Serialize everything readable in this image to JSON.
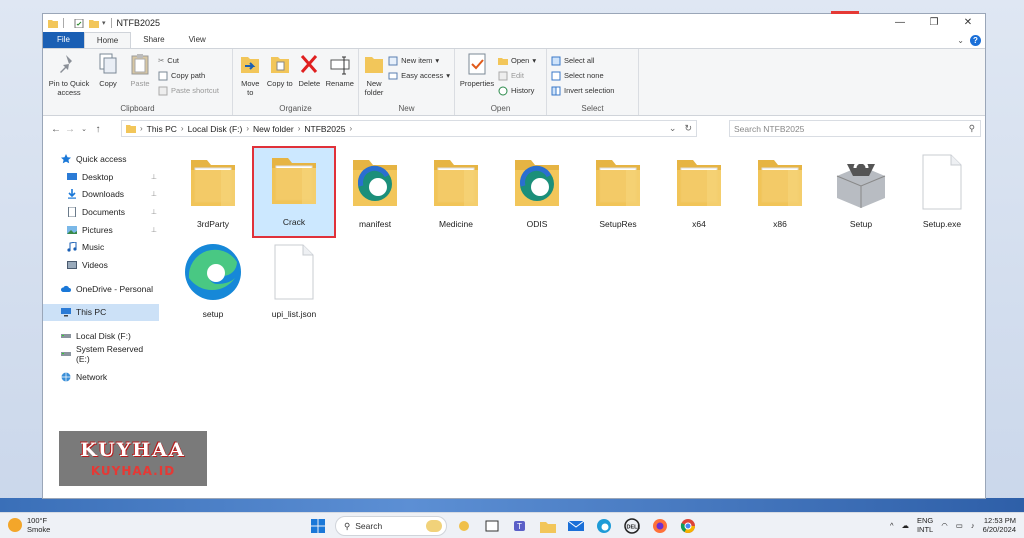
{
  "window": {
    "title": "NTFB2025"
  },
  "ribbon_tabs": [
    "File",
    "Home",
    "Share",
    "View"
  ],
  "ribbon": {
    "clipboard": {
      "pin_label": "Pin to Quick access",
      "copy_label": "Copy",
      "paste_label": "Paste",
      "cut_label": "Cut",
      "copy_path_label": "Copy path",
      "paste_shortcut_label": "Paste shortcut",
      "group_label": "Clipboard"
    },
    "organize": {
      "move_to_label": "Move to",
      "copy_to_label": "Copy to",
      "delete_label": "Delete",
      "rename_label": "Rename",
      "group_label": "Organize"
    },
    "new": {
      "new_folder_label": "New folder",
      "new_item_label": "New item",
      "easy_access_label": "Easy access",
      "group_label": "New"
    },
    "open": {
      "properties_label": "Properties",
      "open_label": "Open",
      "edit_label": "Edit",
      "history_label": "History",
      "group_label": "Open"
    },
    "select": {
      "select_all_label": "Select all",
      "select_none_label": "Select none",
      "invert_selection_label": "Invert selection",
      "group_label": "Select"
    }
  },
  "address": {
    "crumbs": [
      "This PC",
      "Local Disk (F:)",
      "New folder",
      "NTFB2025"
    ],
    "search_placeholder": "Search NTFB2025"
  },
  "sidebar": {
    "items": [
      {
        "label": "Quick access",
        "icon": "star-icon"
      },
      {
        "label": "Desktop",
        "icon": "desktop-icon",
        "pinned": true
      },
      {
        "label": "Downloads",
        "icon": "download-icon",
        "pinned": true
      },
      {
        "label": "Documents",
        "icon": "document-icon",
        "pinned": true
      },
      {
        "label": "Pictures",
        "icon": "picture-icon",
        "pinned": true
      },
      {
        "label": "Music",
        "icon": "music-icon"
      },
      {
        "label": "Videos",
        "icon": "video-icon"
      },
      {
        "label": "OneDrive - Personal",
        "icon": "cloud-icon"
      },
      {
        "label": "This PC",
        "icon": "computer-icon",
        "selected": true
      },
      {
        "label": "Local Disk (F:)",
        "icon": "drive-icon"
      },
      {
        "label": "System Reserved (E:)",
        "icon": "drive-icon"
      },
      {
        "label": "Network",
        "icon": "network-icon"
      }
    ]
  },
  "files": [
    {
      "name": "3rdParty",
      "icon": "folder-icon"
    },
    {
      "name": "Crack",
      "icon": "folder-icon",
      "selected": true
    },
    {
      "name": "manifest",
      "icon": "edge-dev-icon"
    },
    {
      "name": "Medicine",
      "icon": "folder-icon"
    },
    {
      "name": "ODIS",
      "icon": "edge-dev-icon"
    },
    {
      "name": "SetupRes",
      "icon": "folder-icon"
    },
    {
      "name": "x64",
      "icon": "folder-icon"
    },
    {
      "name": "x86",
      "icon": "folder-icon"
    },
    {
      "name": "Setup",
      "icon": "installer-box-icon"
    },
    {
      "name": "Setup.exe",
      "icon": "blank-file-icon"
    },
    {
      "name": "setup",
      "icon": "edge-icon"
    },
    {
      "name": "upi_list.json",
      "icon": "blank-file-icon"
    }
  ],
  "watermark": {
    "top": "KUYHAA",
    "bottom": "KUYHAA.ID"
  },
  "taskbar": {
    "temperature": "100°F",
    "weather": "Smoke",
    "search_label": "Search",
    "lang_1": "ENG",
    "lang_2": "INTL",
    "time": "12:53 PM",
    "date": "6/20/2024"
  },
  "colors": {
    "accent": "#1a5fb4",
    "selection": "#cce8ff",
    "highlight_border": "#e0313a",
    "folder": "#f2c65a"
  }
}
